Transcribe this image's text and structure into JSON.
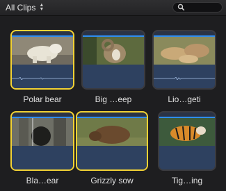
{
  "toolbar": {
    "clips_filter_label": "All Clips"
  },
  "clips": [
    {
      "name": "Polar bear",
      "selected": true,
      "subject": "polar-bear"
    },
    {
      "name": "Big …eep",
      "selected": false,
      "subject": "bighorn-sheep"
    },
    {
      "name": "Lio…geti",
      "selected": false,
      "subject": "lions"
    },
    {
      "name": "Bla…ear",
      "selected": true,
      "subject": "black-bear"
    },
    {
      "name": "Grizzly sow",
      "selected": true,
      "subject": "grizzly"
    },
    {
      "name": "Tig…ing",
      "selected": false,
      "subject": "tiger"
    }
  ],
  "colors": {
    "selection": "#f2d234",
    "accent_line": "#2f8df2",
    "audio": "#2e4160"
  }
}
